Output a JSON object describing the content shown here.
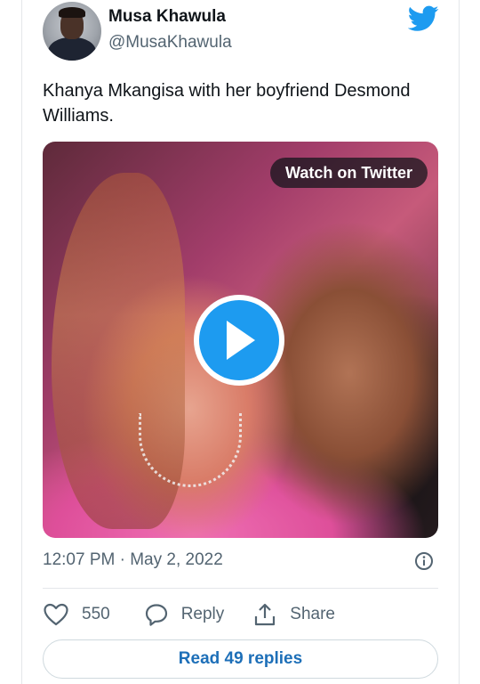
{
  "author": {
    "name": "Musa Khawula",
    "handle": "@MusaKhawula"
  },
  "tweet": {
    "text": "Khanya Mkangisa with her boyfriend Desmond Williams."
  },
  "media": {
    "watch_label": "Watch on Twitter",
    "play_icon": "play-icon"
  },
  "meta": {
    "timestamp": "12:07 PM · May 2, 2022"
  },
  "actions": {
    "like_count": "550",
    "reply_label": "Reply",
    "share_label": "Share"
  },
  "replies": {
    "label": "Read 49 replies"
  },
  "colors": {
    "accent": "#1d9bf0",
    "text": "#0f1419",
    "secondary": "#536471",
    "border": "#e4e7ea"
  },
  "icons": [
    "twitter-bird-icon",
    "play-icon",
    "info-icon",
    "heart-icon",
    "reply-icon",
    "share-icon"
  ]
}
